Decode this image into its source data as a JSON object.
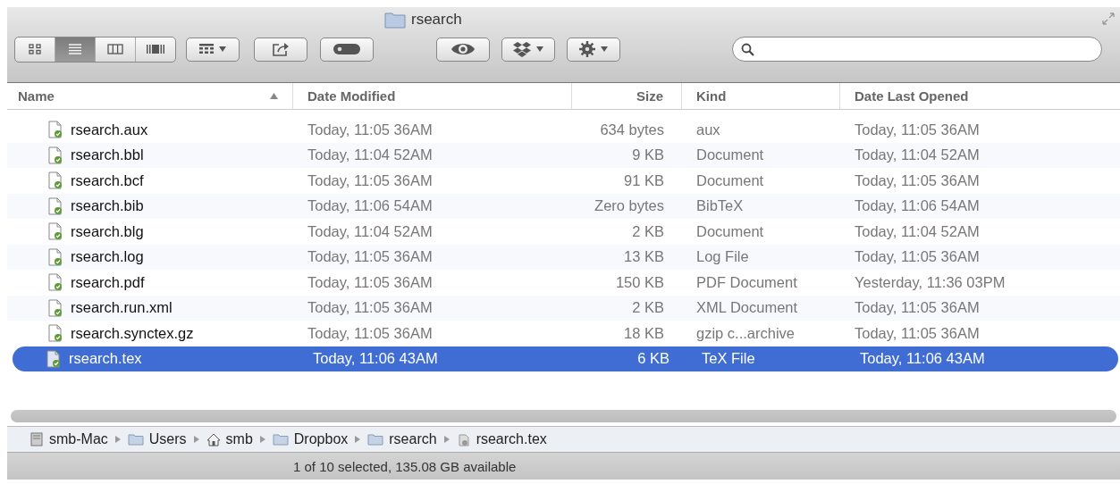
{
  "window": {
    "title": "rsearch"
  },
  "toolbar": {
    "view_buttons": [
      {
        "kind": "icons",
        "selected": false
      },
      {
        "kind": "list",
        "selected": true
      },
      {
        "kind": "columns",
        "selected": false
      },
      {
        "kind": "coverflow",
        "selected": false
      }
    ],
    "buttons": [
      {
        "kind": "arrange",
        "menu": true
      },
      {
        "kind": "share",
        "menu": false
      },
      {
        "kind": "tag",
        "menu": false
      },
      {
        "kind": "quicklook",
        "menu": false
      },
      {
        "kind": "dropbox",
        "menu": true
      },
      {
        "kind": "action",
        "menu": true
      }
    ]
  },
  "table": {
    "columns": [
      {
        "label": "Name",
        "sorted": true
      },
      {
        "label": "Date Modified",
        "sorted": false
      },
      {
        "label": "Size",
        "sorted": false
      },
      {
        "label": "Kind",
        "sorted": false
      },
      {
        "label": "Date Last Opened",
        "sorted": false
      }
    ],
    "rows": [
      {
        "name": "rsearch.aux",
        "modified": "Today, 11:05 36AM",
        "size": "634 bytes",
        "kind": "aux",
        "opened": "Today, 11:05 36AM",
        "selected": false
      },
      {
        "name": "rsearch.bbl",
        "modified": "Today, 11:04 52AM",
        "size": "9 KB",
        "kind": "Document",
        "opened": "Today, 11:04 52AM",
        "selected": false
      },
      {
        "name": "rsearch.bcf",
        "modified": "Today, 11:05 36AM",
        "size": "91 KB",
        "kind": "Document",
        "opened": "Today, 11:05 36AM",
        "selected": false
      },
      {
        "name": "rsearch.bib",
        "modified": "Today, 11:06 54AM",
        "size": "Zero bytes",
        "kind": "BibTeX",
        "opened": "Today, 11:06 54AM",
        "selected": false
      },
      {
        "name": "rsearch.blg",
        "modified": "Today, 11:04 52AM",
        "size": "2 KB",
        "kind": "Document",
        "opened": "Today, 11:04 52AM",
        "selected": false
      },
      {
        "name": "rsearch.log",
        "modified": "Today, 11:05 36AM",
        "size": "13 KB",
        "kind": "Log File",
        "opened": "Today, 11:05 36AM",
        "selected": false
      },
      {
        "name": "rsearch.pdf",
        "modified": "Today, 11:05 36AM",
        "size": "150 KB",
        "kind": "PDF Document",
        "opened": "Yesterday, 11:36 03PM",
        "selected": false
      },
      {
        "name": "rsearch.run.xml",
        "modified": "Today, 11:05 36AM",
        "size": "2 KB",
        "kind": "XML Document",
        "opened": "Today, 11:05 36AM",
        "selected": false
      },
      {
        "name": "rsearch.synctex.gz",
        "modified": "Today, 11:05 36AM",
        "size": "18 KB",
        "kind": "gzip c...archive",
        "opened": "Today, 11:05 36AM",
        "selected": false
      },
      {
        "name": "rsearch.tex",
        "modified": "Today, 11:06 43AM",
        "size": "6 KB",
        "kind": "TeX File",
        "opened": "Today, 11:06 43AM",
        "selected": true
      }
    ]
  },
  "path_bar": [
    {
      "label": "smb-Mac",
      "kind": "computer"
    },
    {
      "label": "Users",
      "kind": "folder"
    },
    {
      "label": "smb",
      "kind": "home"
    },
    {
      "label": "Dropbox",
      "kind": "folder"
    },
    {
      "label": "rsearch",
      "kind": "folder"
    },
    {
      "label": "rsearch.tex",
      "kind": "file"
    }
  ],
  "status_bar": "1 of 10 selected, 135.08 GB available"
}
